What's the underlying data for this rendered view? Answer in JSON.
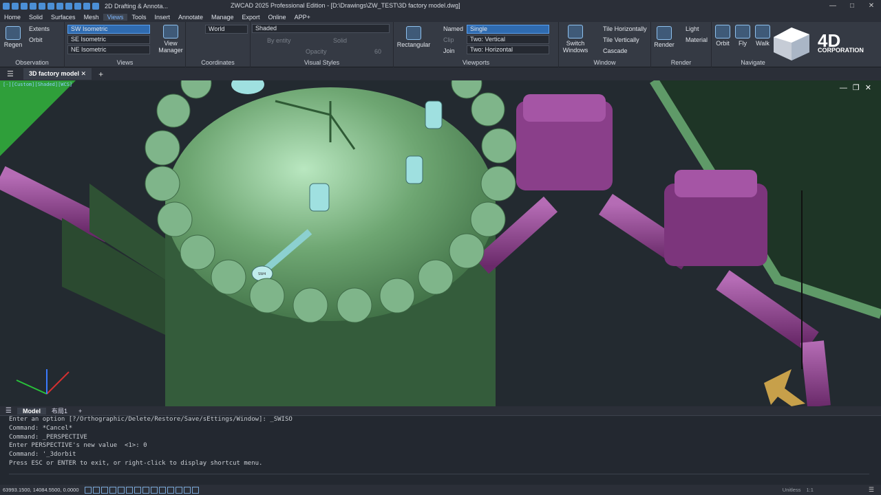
{
  "titlebar": {
    "workspace": "2D Drafting & Annota...",
    "title": "ZWCAD 2025 Professional Edition - [D:\\Drawings\\ZW_TEST\\3D factory model.dwg]"
  },
  "menu": [
    "Home",
    "Solid",
    "Surfaces",
    "Mesh",
    "Views",
    "Tools",
    "Insert",
    "Annotate",
    "Manage",
    "Export",
    "Online",
    "APP+"
  ],
  "active_menu": "Views",
  "ribbon": {
    "observation": {
      "title": "Observation",
      "regen": "Regen",
      "extents": "Extents",
      "orbit": "Orbit"
    },
    "views": {
      "title": "Views",
      "items": [
        "SW Isometric",
        "SE Isometric",
        "NE Isometric"
      ],
      "selected": "SW Isometric",
      "view_manager": "View Manager"
    },
    "coordinates": {
      "title": "Coordinates",
      "world": "World"
    },
    "visual_styles": {
      "title": "Visual Styles",
      "style": "Shaded",
      "by_entity": "By entity",
      "solid": "Solid",
      "opacity": "Opacity",
      "opacity_value": "60"
    },
    "viewports": {
      "title": "Viewports",
      "rectangular": "Rectangular",
      "named": "Named",
      "clip": "Clip",
      "join": "Join",
      "single": "Single",
      "two_v_prefix": "Two:",
      "two_v": "Vertical",
      "two_h_prefix": "Two:",
      "two_h": "Horizontal"
    },
    "window": {
      "title": "Window",
      "switch_windows": "Switch Windows",
      "tile_h": "Tile Horizontally",
      "tile_v": "Tile Vertically",
      "cascade": "Cascade"
    },
    "render": {
      "title": "Render",
      "render": "Render",
      "light": "Light",
      "material": "Material"
    },
    "navigate": {
      "title": "Navigate",
      "orbit": "Orbit",
      "fly": "Fly",
      "walk": "Walk"
    },
    "logo_text": "4D",
    "logo_sub": "CORPORATION"
  },
  "tabs": {
    "doc": "3D factory model"
  },
  "viewport": {
    "label": "[-][Custom][Shaded][WCS]",
    "marker": "SW4"
  },
  "layout_tabs": [
    "Model",
    "布局1"
  ],
  "command_lines": [
    "Enter an option [?/Orthographic/Delete/Restore/Save/sEttings/Window]: _SWISO",
    "Command: *Cancel*",
    "Command: _PERSPECTIVE",
    "Enter PERSPECTIVE's new value  <1>: 0",
    "Command: '_3dorbit",
    "Press ESC or ENTER to exit, or right-click to display shortcut menu."
  ],
  "status": {
    "coords": "63993.1500, 14084.5500, 0.0000",
    "units": "Unitless",
    "scale": "1:1"
  },
  "colors": {
    "tank": "#5d9a63",
    "pipe": "#8a3f8a",
    "accent": "#2f6bb0"
  }
}
